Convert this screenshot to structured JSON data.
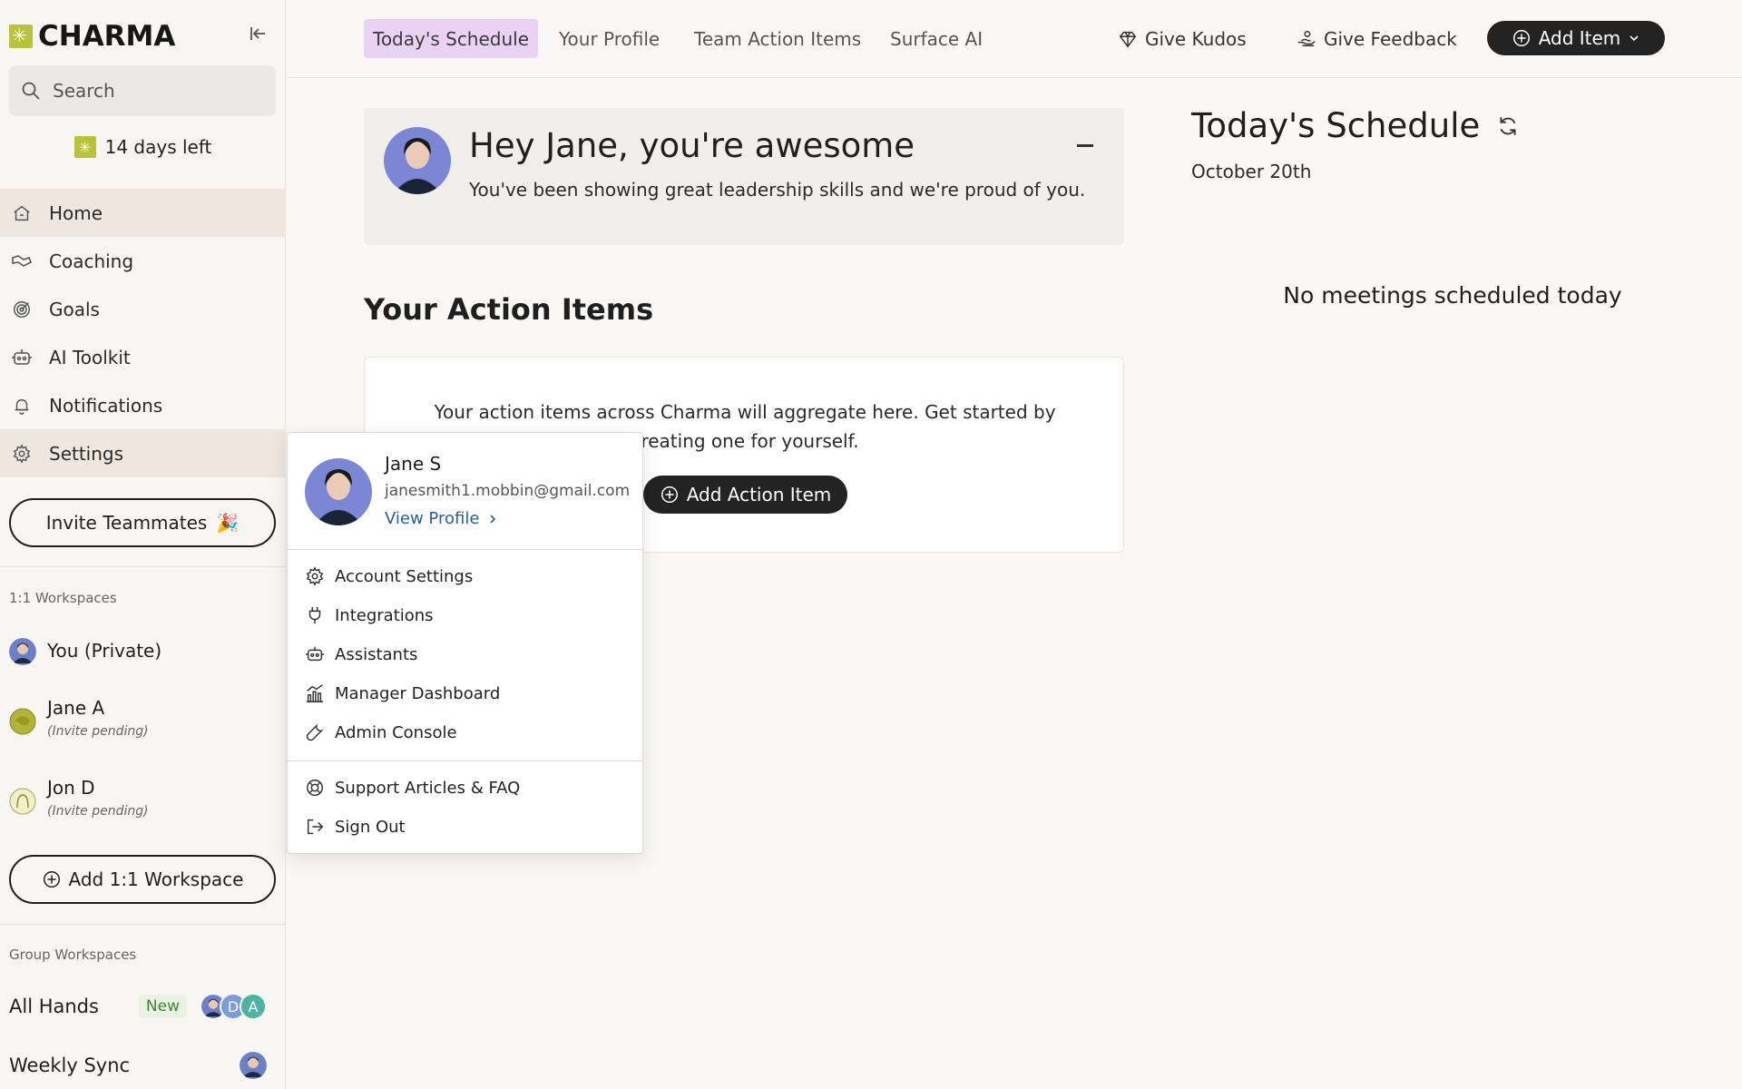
{
  "brand": {
    "name": "CHARMA"
  },
  "search": {
    "placeholder": "Search"
  },
  "trial": {
    "label": "14 days left"
  },
  "nav": {
    "items": [
      {
        "label": "Home",
        "icon": "home-icon"
      },
      {
        "label": "Coaching",
        "icon": "coaching-icon"
      },
      {
        "label": "Goals",
        "icon": "target-icon"
      },
      {
        "label": "AI Toolkit",
        "icon": "robot-icon"
      },
      {
        "label": "Notifications",
        "icon": "bell-icon"
      },
      {
        "label": "Settings",
        "icon": "gear-icon"
      }
    ]
  },
  "invite": {
    "label": "Invite Teammates",
    "emoji": "🎉"
  },
  "workspaces": {
    "section_label": "1:1 Workspaces",
    "items": [
      {
        "name": "You (Private)",
        "sub": ""
      },
      {
        "name": "Jane A",
        "sub": "(Invite pending)"
      },
      {
        "name": "Jon D",
        "sub": "(Invite pending)"
      }
    ],
    "add_label": "Add 1:1 Workspace"
  },
  "groups": {
    "section_label": "Group Workspaces",
    "items": [
      {
        "name": "All Hands",
        "badge": "New",
        "chips": [
          "D",
          "A"
        ]
      },
      {
        "name": "Weekly Sync"
      }
    ]
  },
  "topbar": {
    "tabs": [
      "Today's Schedule",
      "Your Profile",
      "Team Action Items",
      "Surface AI"
    ],
    "kudos_label": "Give Kudos",
    "feedback_label": "Give Feedback",
    "add_item_label": "Add Item"
  },
  "kudos_card": {
    "title": "Hey Jane, you're awesome",
    "text": "You've been showing great leadership skills and we're proud of you."
  },
  "action_items": {
    "heading": "Your Action Items",
    "empty_text": "Your action items across Charma will aggregate here. Get started by creating one for yourself.",
    "add_label": "Add Action Item"
  },
  "schedule": {
    "title": "Today's Schedule",
    "date": "October 20th",
    "empty": "No meetings scheduled today"
  },
  "profile_menu": {
    "name": "Jane S",
    "email": "janesmith1.mobbin@gmail.com",
    "view_profile": "View Profile",
    "items_a": [
      {
        "label": "Account Settings",
        "icon": "gear-icon"
      },
      {
        "label": "Integrations",
        "icon": "plug-icon"
      },
      {
        "label": "Assistants",
        "icon": "robot-icon"
      },
      {
        "label": "Manager Dashboard",
        "icon": "chart-icon"
      },
      {
        "label": "Admin Console",
        "icon": "wrench-icon"
      }
    ],
    "items_b": [
      {
        "label": "Support Articles & FAQ",
        "icon": "lifebuoy-icon"
      },
      {
        "label": "Sign Out",
        "icon": "sign-out-icon"
      }
    ]
  },
  "colors": {
    "brand_accent": "#b8c23a",
    "active_tab_bg": "#e9d2f3",
    "nav_active_bg": "#eee6df",
    "primary_button": "#232323",
    "new_badge_text": "#3e8b2f"
  }
}
